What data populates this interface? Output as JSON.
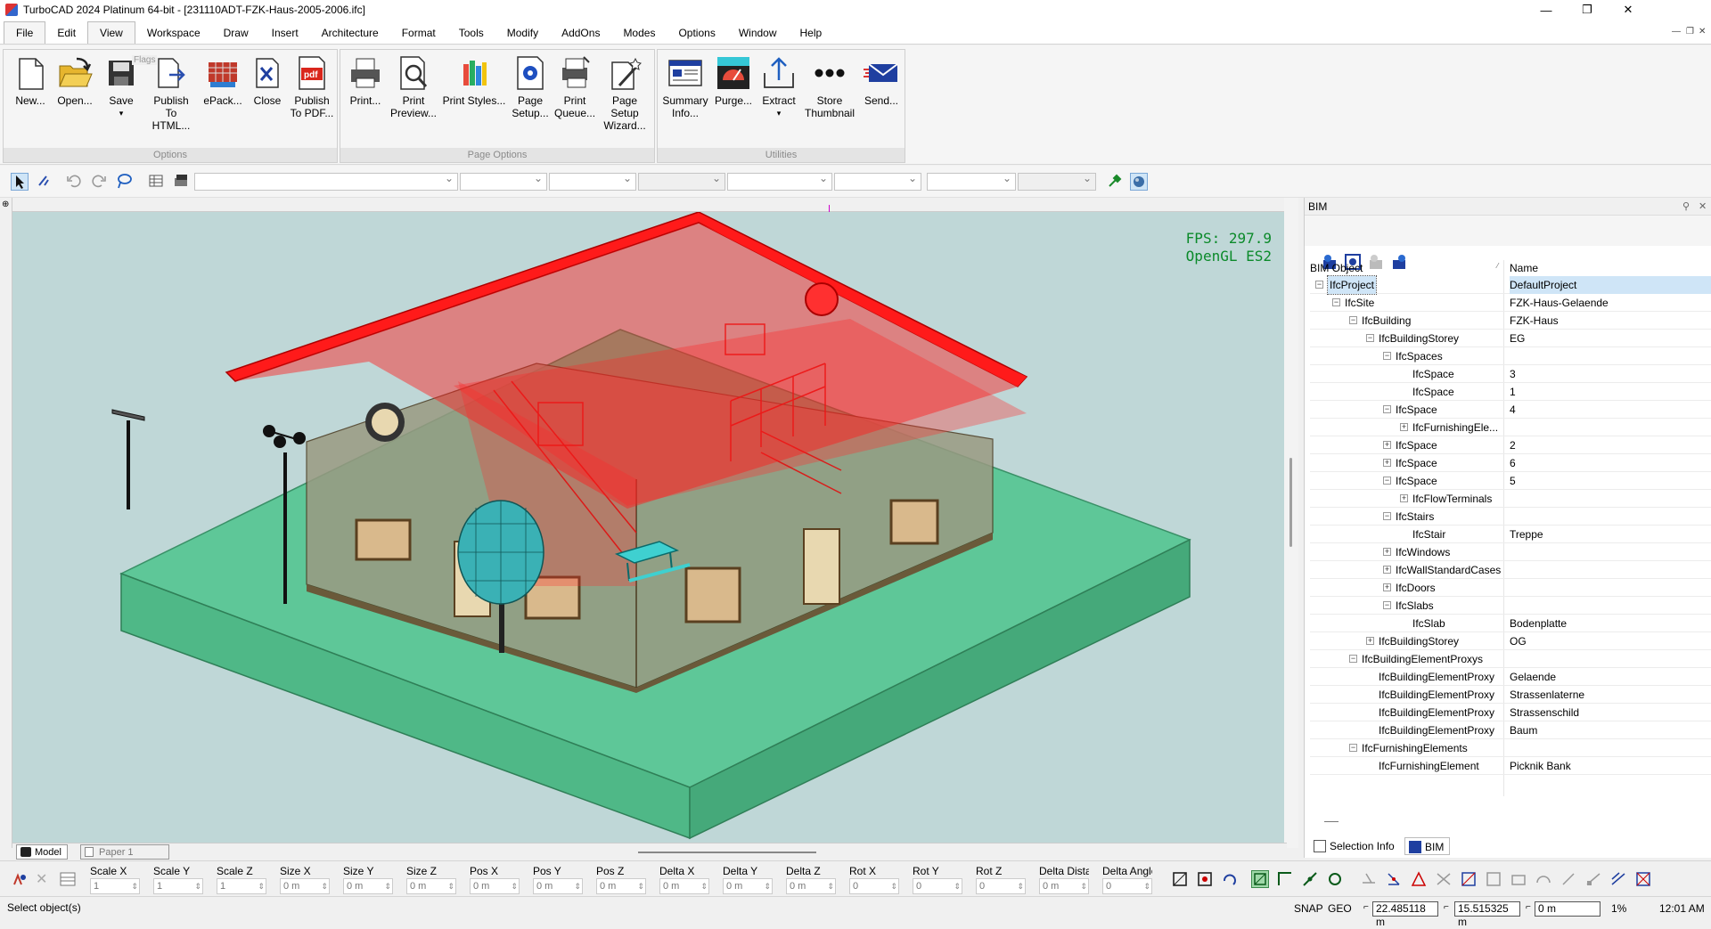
{
  "window": {
    "title": "TurboCAD 2024 Platinum 64-bit - [231110ADT-FZK-Haus-2005-2006.ifc]",
    "minimize": "—",
    "maximize": "❐",
    "close": "✕"
  },
  "menu": [
    "File",
    "Edit",
    "View",
    "Workspace",
    "Draw",
    "Insert",
    "Architecture",
    "Format",
    "Tools",
    "Modify",
    "AddOns",
    "Modes",
    "Options",
    "Window",
    "Help"
  ],
  "ribbon": {
    "tooltip": "Flags",
    "groups": {
      "options": "Options",
      "page_options": "Page Options",
      "utilities": "Utilities"
    },
    "buttons": [
      {
        "line1": "New...",
        "line2": ""
      },
      {
        "line1": "Open...",
        "line2": ""
      },
      {
        "line1": "Save",
        "line2": "▾"
      },
      {
        "line1": "Publish",
        "line2": "To HTML..."
      },
      {
        "line1": "ePack...",
        "line2": ""
      },
      {
        "line1": "Close",
        "line2": ""
      },
      {
        "line1": "Publish",
        "line2": "To PDF..."
      },
      {
        "line1": "Print...",
        "line2": ""
      },
      {
        "line1": "Print",
        "line2": "Preview..."
      },
      {
        "line1": "Print Styles...",
        "line2": ""
      },
      {
        "line1": "Page",
        "line2": "Setup..."
      },
      {
        "line1": "Print",
        "line2": "Queue..."
      },
      {
        "line1": "Page Setup",
        "line2": "Wizard..."
      },
      {
        "line1": "Summary",
        "line2": "Info..."
      },
      {
        "line1": "Purge...",
        "line2": ""
      },
      {
        "line1": "Extract",
        "line2": "▾"
      },
      {
        "line1": "Store",
        "line2": "Thumbnail"
      },
      {
        "line1": "Send...",
        "line2": ""
      }
    ]
  },
  "viewport": {
    "fps": "FPS: 297.9",
    "renderer": "OpenGL ES2",
    "tabs": [
      "Model",
      "Paper 1"
    ]
  },
  "bim": {
    "title": "BIM",
    "col_object": "BIM Object",
    "col_name": "Name",
    "tabs": [
      "Selection Info",
      "BIM"
    ],
    "tree": [
      {
        "label": "IfcProject",
        "value": "DefaultProject",
        "level": 0,
        "toggle": "-",
        "selected": true
      },
      {
        "label": "IfcSite",
        "value": "FZK-Haus-Gelaende",
        "level": 1,
        "toggle": "-"
      },
      {
        "label": "IfcBuilding",
        "value": "FZK-Haus",
        "level": 2,
        "toggle": "-"
      },
      {
        "label": "IfcBuildingStorey",
        "value": "EG",
        "level": 3,
        "toggle": "-"
      },
      {
        "label": "IfcSpaces",
        "value": "",
        "level": 4,
        "toggle": "-"
      },
      {
        "label": "IfcSpace",
        "value": "3",
        "level": 5,
        "toggle": ""
      },
      {
        "label": "IfcSpace",
        "value": "1",
        "level": 5,
        "toggle": ""
      },
      {
        "label": "IfcSpace",
        "value": "4",
        "level": 4,
        "toggle": "-"
      },
      {
        "label": "IfcFurnishingEle...",
        "value": "",
        "level": 5,
        "toggle": "+"
      },
      {
        "label": "IfcSpace",
        "value": "2",
        "level": 4,
        "toggle": "+"
      },
      {
        "label": "IfcSpace",
        "value": "6",
        "level": 4,
        "toggle": "+"
      },
      {
        "label": "IfcSpace",
        "value": "5",
        "level": 4,
        "toggle": "-"
      },
      {
        "label": "IfcFlowTerminals",
        "value": "",
        "level": 5,
        "toggle": "+"
      },
      {
        "label": "IfcStairs",
        "value": "",
        "level": 4,
        "toggle": "-"
      },
      {
        "label": "IfcStair",
        "value": "Treppe",
        "level": 5,
        "toggle": ""
      },
      {
        "label": "IfcWindows",
        "value": "",
        "level": 4,
        "toggle": "+"
      },
      {
        "label": "IfcWallStandardCases",
        "value": "",
        "level": 4,
        "toggle": "+"
      },
      {
        "label": "IfcDoors",
        "value": "",
        "level": 4,
        "toggle": "+"
      },
      {
        "label": "IfcSlabs",
        "value": "",
        "level": 4,
        "toggle": "-"
      },
      {
        "label": "IfcSlab",
        "value": "Bodenplatte",
        "level": 5,
        "toggle": ""
      },
      {
        "label": "IfcBuildingStorey",
        "value": "OG",
        "level": 3,
        "toggle": "+"
      },
      {
        "label": "IfcBuildingElementProxys",
        "value": "",
        "level": 2,
        "toggle": "-"
      },
      {
        "label": "IfcBuildingElementProxy",
        "value": "Gelaende",
        "level": 3,
        "toggle": ""
      },
      {
        "label": "IfcBuildingElementProxy",
        "value": "Strassenlaterne",
        "level": 3,
        "toggle": ""
      },
      {
        "label": "IfcBuildingElementProxy",
        "value": "Strassenschild",
        "level": 3,
        "toggle": ""
      },
      {
        "label": "IfcBuildingElementProxy",
        "value": "Baum",
        "level": 3,
        "toggle": ""
      },
      {
        "label": "IfcFurnishingElements",
        "value": "",
        "level": 2,
        "toggle": "-"
      },
      {
        "label": "IfcFurnishingElement",
        "value": "Picknik Bank",
        "level": 3,
        "toggle": ""
      }
    ]
  },
  "inspector": {
    "fields": [
      {
        "label": "Scale X",
        "value": "1"
      },
      {
        "label": "Scale Y",
        "value": "1"
      },
      {
        "label": "Scale Z",
        "value": "1"
      },
      {
        "label": "Size X",
        "value": "0 m"
      },
      {
        "label": "Size Y",
        "value": "0 m"
      },
      {
        "label": "Size Z",
        "value": "0 m"
      },
      {
        "label": "Pos X",
        "value": "0 m"
      },
      {
        "label": "Pos Y",
        "value": "0 m"
      },
      {
        "label": "Pos Z",
        "value": "0 m"
      },
      {
        "label": "Delta X",
        "value": "0 m"
      },
      {
        "label": "Delta Y",
        "value": "0 m"
      },
      {
        "label": "Delta Z",
        "value": "0 m"
      },
      {
        "label": "Rot X",
        "value": "0"
      },
      {
        "label": "Rot Y",
        "value": "0"
      },
      {
        "label": "Rot Z",
        "value": "0"
      },
      {
        "label": "Delta Distanc",
        "value": "0 m"
      },
      {
        "label": "Delta Angle",
        "value": "0"
      }
    ]
  },
  "status": {
    "prompt": "Select object(s)",
    "snap": "SNAP",
    "geo": "GEO",
    "x": "22.485118 m",
    "y": "15.515325 m",
    "z": "0 m",
    "zoom": "1%",
    "time": "12:01 AM"
  },
  "colors": {
    "roof": "#ff1a1a",
    "ground": "#4fc58e",
    "sky": "#bfd7d7",
    "fps": "#0b8a2a"
  }
}
